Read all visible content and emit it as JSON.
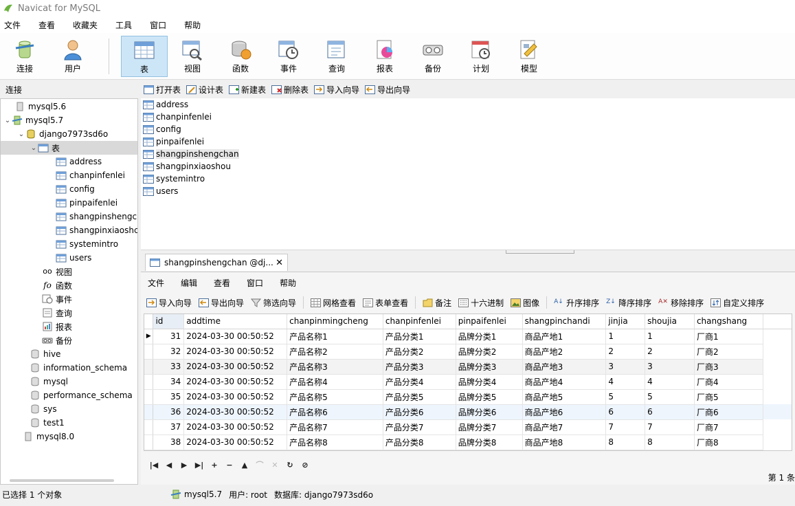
{
  "window": {
    "title": "Navicat for MySQL"
  },
  "menu": [
    "文件",
    "查看",
    "收藏夹",
    "工具",
    "窗口",
    "帮助"
  ],
  "ribbon": [
    {
      "label": "连接",
      "icon": "connection-icon"
    },
    {
      "label": "用户",
      "icon": "user-icon"
    },
    {
      "label": "表",
      "icon": "table-icon"
    },
    {
      "label": "视图",
      "icon": "view-icon"
    },
    {
      "label": "函数",
      "icon": "function-icon"
    },
    {
      "label": "事件",
      "icon": "event-icon"
    },
    {
      "label": "查询",
      "icon": "query-icon"
    },
    {
      "label": "报表",
      "icon": "report-icon"
    },
    {
      "label": "备份",
      "icon": "backup-icon"
    },
    {
      "label": "计划",
      "icon": "schedule-icon"
    },
    {
      "label": "模型",
      "icon": "model-icon"
    }
  ],
  "connection_label": "连接",
  "object_toolbar": [
    "打开表",
    "设计表",
    "新建表",
    "删除表",
    "导入向导",
    "导出向导"
  ],
  "tree": {
    "mysql56": "mysql5.6",
    "mysql57": "mysql5.7",
    "db": "django7973sd6o",
    "tables_folder": "表",
    "tables": [
      "address",
      "chanpinfenlei",
      "config",
      "pinpaifenlei",
      "shangpinshengcl",
      "shangpinxiaoshc",
      "systemintro",
      "users"
    ],
    "folders": [
      "视图",
      "函数",
      "事件",
      "查询",
      "报表",
      "备份"
    ],
    "other_dbs": [
      "hive",
      "information_schema",
      "mysql",
      "performance_schema",
      "sys",
      "test1"
    ],
    "mysql80": "mysql8.0"
  },
  "table_list": [
    "address",
    "chanpinfenlei",
    "config",
    "pinpaifenlei",
    "shangpinshengchan",
    "shangpinxiaoshou",
    "systemintro",
    "users"
  ],
  "data_tab": {
    "title": "shangpinshengchan @dj...",
    "close": "✕"
  },
  "data_menu": [
    "文件",
    "编辑",
    "查看",
    "窗口",
    "帮助"
  ],
  "data_toolbar": [
    "导入向导",
    "导出向导",
    "筛选向导",
    "网格查看",
    "表单查看",
    "备注",
    "十六进制",
    "图像",
    "升序排序",
    "降序排序",
    "移除排序",
    "自定义排序"
  ],
  "grid": {
    "columns": [
      "id",
      "addtime",
      "chanpinmingcheng",
      "chanpinfenlei",
      "pinpaifenlei",
      "shangpinchandi",
      "jinjia",
      "shoujia",
      "changshang"
    ],
    "rows": [
      [
        "31",
        "2024-03-30 00:50:52",
        "产品名称1",
        "产品分类1",
        "品牌分类1",
        "商品产地1",
        "1",
        "1",
        "厂商1"
      ],
      [
        "32",
        "2024-03-30 00:50:52",
        "产品名称2",
        "产品分类2",
        "品牌分类2",
        "商品产地2",
        "2",
        "2",
        "厂商2"
      ],
      [
        "33",
        "2024-03-30 00:50:52",
        "产品名称3",
        "产品分类3",
        "品牌分类3",
        "商品产地3",
        "3",
        "3",
        "厂商3"
      ],
      [
        "34",
        "2024-03-30 00:50:52",
        "产品名称4",
        "产品分类4",
        "品牌分类4",
        "商品产地4",
        "4",
        "4",
        "厂商4"
      ],
      [
        "35",
        "2024-03-30 00:50:52",
        "产品名称5",
        "产品分类5",
        "品牌分类5",
        "商品产地5",
        "5",
        "5",
        "厂商5"
      ],
      [
        "36",
        "2024-03-30 00:50:52",
        "产品名称6",
        "产品分类6",
        "品牌分类6",
        "商品产地6",
        "6",
        "6",
        "厂商6"
      ],
      [
        "37",
        "2024-03-30 00:50:52",
        "产品名称7",
        "产品分类7",
        "品牌分类7",
        "商品产地7",
        "7",
        "7",
        "厂商7"
      ],
      [
        "38",
        "2024-03-30 00:50:52",
        "产品名称8",
        "产品分类8",
        "品牌分类8",
        "商品产地8",
        "8",
        "8",
        "厂商8"
      ]
    ],
    "current_row_marker": "▶"
  },
  "nav_buttons": [
    "|◀",
    "◀",
    "▶",
    "▶|",
    "+",
    "−",
    "▲",
    "⌒",
    "✕",
    "↻",
    "⊘"
  ],
  "record_status": "第 1 条",
  "status": {
    "selection": "已选择 1 个对象",
    "connection": "mysql5.7",
    "user": "用户: root",
    "database": "数据库: django7973sd6o"
  }
}
